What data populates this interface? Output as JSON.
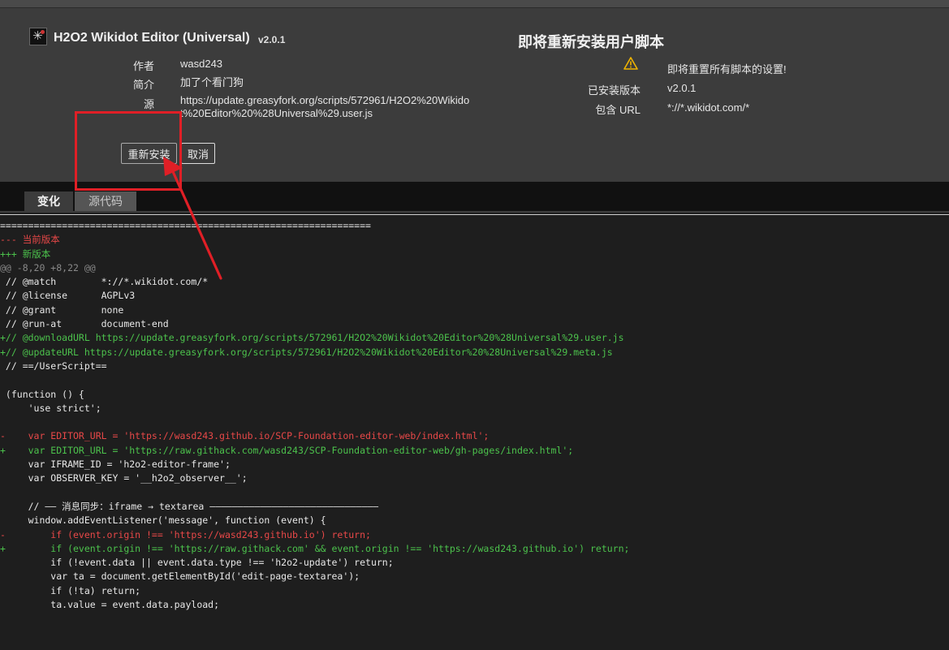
{
  "header": {
    "script_title": "H2O2 Wikidot Editor (Universal)",
    "version": "v2.0.1",
    "author_label": "作者",
    "author": "wasd243",
    "description_label": "简介",
    "description": "加了个看门狗",
    "source_label": "源",
    "source": "https://update.greasyfork.org/scripts/572961/H2O2%20Wikidot%20Editor%20%28Universal%29.user.js",
    "reinstall_button": "重新安装",
    "cancel_button": "取消"
  },
  "info": {
    "title": "即将重新安装用户脚本",
    "warning": "即将重置所有脚本的设置!",
    "installed_version_label": "已安装版本",
    "installed_version": "v2.0.1",
    "include_url_label": "包含 URL",
    "include_url": "*://*.wikidot.com/*"
  },
  "tabs": [
    {
      "label": "变化",
      "active": true
    },
    {
      "label": "源代码",
      "active": false
    }
  ],
  "colors": {
    "removed": "#e84848",
    "added": "#4cc24c",
    "annotation": "#e01f26",
    "warning": "#f0b400"
  },
  "diff_lines": [
    {
      "type": "sep",
      "text": "=================================================================="
    },
    {
      "type": "rem",
      "text": "--- 当前版本"
    },
    {
      "type": "add",
      "text": "+++ 新版本"
    },
    {
      "type": "hunk",
      "text": "@@ -8,20 +8,22 @@"
    },
    {
      "type": "ctx",
      "text": " // @match        *://*.wikidot.com/*"
    },
    {
      "type": "ctx",
      "text": " // @license      AGPLv3"
    },
    {
      "type": "ctx",
      "text": " // @grant        none"
    },
    {
      "type": "ctx",
      "text": " // @run-at       document-end"
    },
    {
      "type": "add",
      "text": "+// @downloadURL https://update.greasyfork.org/scripts/572961/H2O2%20Wikidot%20Editor%20%28Universal%29.user.js"
    },
    {
      "type": "add",
      "text": "+// @updateURL https://update.greasyfork.org/scripts/572961/H2O2%20Wikidot%20Editor%20%28Universal%29.meta.js"
    },
    {
      "type": "ctx",
      "text": " // ==/UserScript=="
    },
    {
      "type": "ctx",
      "text": " "
    },
    {
      "type": "ctx",
      "text": " (function () {"
    },
    {
      "type": "ctx",
      "text": "     'use strict';"
    },
    {
      "type": "ctx",
      "text": " "
    },
    {
      "type": "rem",
      "text": "-    var EDITOR_URL = 'https://wasd243.github.io/SCP-Foundation-editor-web/index.html';"
    },
    {
      "type": "add",
      "text": "+    var EDITOR_URL = 'https://raw.githack.com/wasd243/SCP-Foundation-editor-web/gh-pages/index.html';"
    },
    {
      "type": "ctx",
      "text": "     var IFRAME_ID = 'h2o2-editor-frame';"
    },
    {
      "type": "ctx",
      "text": "     var OBSERVER_KEY = '__h2o2_observer__';"
    },
    {
      "type": "ctx",
      "text": " "
    },
    {
      "type": "ctx",
      "text": "     // —— 消息同步：iframe → textarea ——————————————————————————————"
    },
    {
      "type": "ctx",
      "text": "     window.addEventListener('message', function (event) {"
    },
    {
      "type": "rem",
      "text": "-        if (event.origin !== 'https://wasd243.github.io') return;"
    },
    {
      "type": "add",
      "text": "+        if (event.origin !== 'https://raw.githack.com' && event.origin !== 'https://wasd243.github.io') return;"
    },
    {
      "type": "ctx",
      "text": "         if (!event.data || event.data.type !== 'h2o2-update') return;"
    },
    {
      "type": "ctx",
      "text": "         var ta = document.getElementById('edit-page-textarea');"
    },
    {
      "type": "ctx",
      "text": "         if (!ta) return;"
    },
    {
      "type": "ctx",
      "text": "         ta.value = event.data.payload;"
    }
  ]
}
